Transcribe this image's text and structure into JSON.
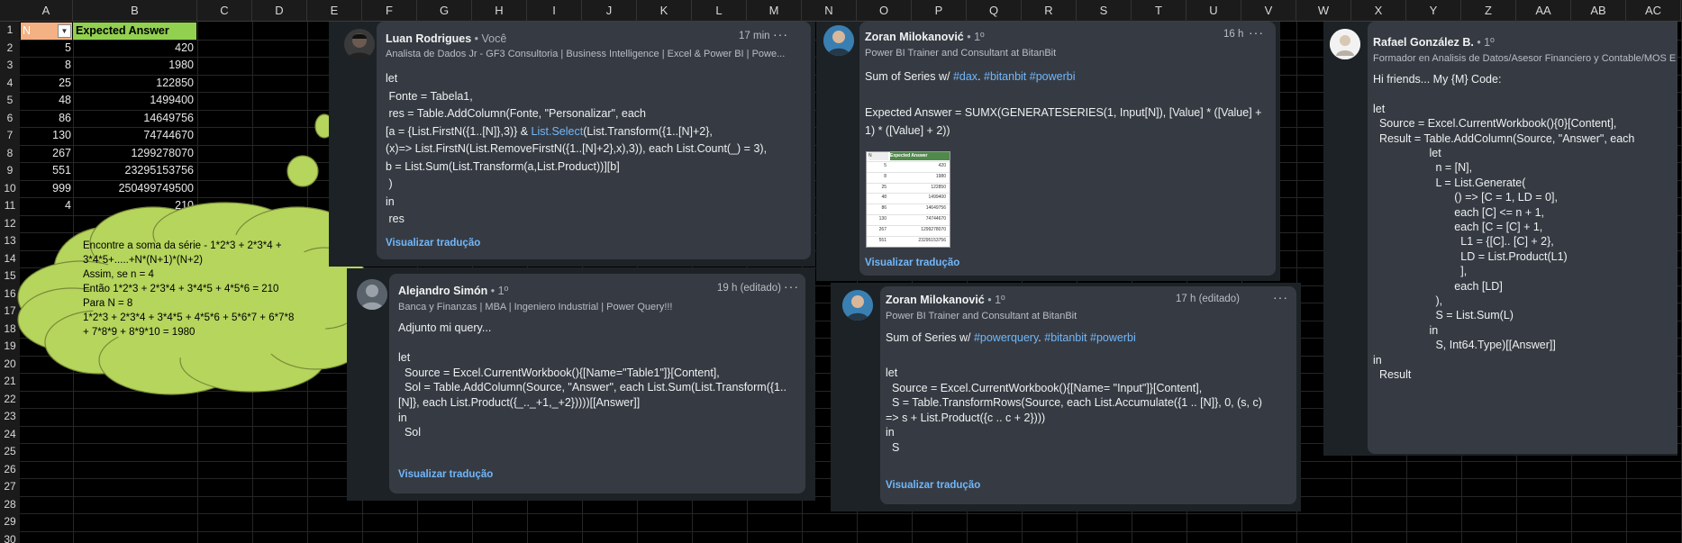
{
  "spreadsheet": {
    "columns": [
      "A",
      "B",
      "C",
      "D",
      "E",
      "F",
      "G",
      "H",
      "I",
      "J",
      "K",
      "L",
      "M",
      "N",
      "O",
      "P",
      "Q",
      "R",
      "S",
      "T",
      "U",
      "V",
      "W",
      "X",
      "Y",
      "Z",
      "AA",
      "AB",
      "AC"
    ],
    "rows": [
      "1",
      "2",
      "3",
      "4",
      "5",
      "6",
      "7",
      "8",
      "9",
      "10",
      "11",
      "12",
      "13",
      "14",
      "15",
      "16",
      "17",
      "18",
      "19",
      "20",
      "21",
      "22",
      "23",
      "24",
      "25",
      "26",
      "27",
      "28",
      "29",
      "30"
    ],
    "header_n": "N",
    "header_expected": "Expected Answer",
    "data": [
      {
        "n": "5",
        "answer": "420"
      },
      {
        "n": "8",
        "answer": "1980"
      },
      {
        "n": "25",
        "answer": "122850"
      },
      {
        "n": "48",
        "answer": "1499400"
      },
      {
        "n": "86",
        "answer": "14649756"
      },
      {
        "n": "130",
        "answer": "74744670"
      },
      {
        "n": "267",
        "answer": "1299278070"
      },
      {
        "n": "551",
        "answer": "23295153756"
      },
      {
        "n": "999",
        "answer": "250499749500"
      },
      {
        "n": "4",
        "answer": "210"
      }
    ]
  },
  "bubble": {
    "color": "#b5d55c",
    "lines": [
      "Encontre a soma da série - 1*2*3 + 2*3*4 +",
      "3*4*5+.....+N*(N+1)*(N+2)",
      "Assim, se n = 4",
      "Então 1*2*3 + 2*3*4 + 3*4*5 + 4*5*6 = 210",
      "Para N = 8",
      "1*2*3 + 2*3*4 + 3*4*5 + 4*5*6 + 5*6*7 + 6*7*8",
      "+ 7*8*9 + 8*9*10 = 1980"
    ]
  },
  "comments": {
    "luan": {
      "name": "Luan Rodrigues",
      "degree": " • Você",
      "subtitle": "Analista de Dados Jr - GF3 Consultoria | Business Intelligence | Excel & Power BI | Powe...",
      "time": "17 min",
      "more": "···",
      "lines": [
        "let",
        " Fonte = Tabela1,",
        " res = Table.AddColumn(Fonte, \"Personalizar\", each",
        "[a = {List.FirstN({1..[N]},3)} & ",
        "(x)=> List.FirstN(List.RemoveFirstN({1..[N]+2},x),3)), each List.Count(_) = 3),",
        "b = List.Sum(List.Transform(a,List.Product))][b]",
        " )",
        "in",
        " res"
      ],
      "line4_link": "List.Select",
      "line4_tail": "(List.Transform({1..[N]+2},",
      "translate": "Visualizar tradução"
    },
    "zoran1": {
      "name": "Zoran Milokanović",
      "degree": " • 1º",
      "subtitle": "Power BI Trainer and Consultant at BitanBit",
      "time": "16 h",
      "more": "···",
      "intro": "Sum of Series w/ ",
      "tag1": "#dax",
      "sep": ". ",
      "tag2": "#bitanbit",
      "space": " ",
      "tag3": "#powerbi",
      "formula1": "Expected Answer = SUMX(GENERATESERIES(1, Input[N]), [Value] * ([Value] +",
      "formula2": "1) * ([Value] + 2))",
      "translate": "Visualizar tradução",
      "thumb": {
        "h1": "N",
        "h2": "Expected Answer",
        "rows": [
          {
            "n": "5",
            "v": "420"
          },
          {
            "n": "8",
            "v": "1980"
          },
          {
            "n": "25",
            "v": "122850"
          },
          {
            "n": "48",
            "v": "1499400"
          },
          {
            "n": "86",
            "v": "14649756"
          },
          {
            "n": "130",
            "v": "74744670"
          },
          {
            "n": "267",
            "v": "1299278070"
          },
          {
            "n": "551",
            "v": "23295153756"
          }
        ]
      }
    },
    "rafael": {
      "name": "Rafael González B.",
      "degree": " • 1º",
      "subtitle": "Formador en Analisis de Datos/Asesor Financiero y Contable/MOS E",
      "lines": [
        "Hi friends... My {M} Code:",
        "",
        "let",
        "  Source = Excel.CurrentWorkbook(){0}[Content],",
        "  Result = Table.AddColumn(Source, \"Answer\", each",
        "                  let",
        "                    n = [N],",
        "                    L = List.Generate(",
        "                          () => [C = 1, LD = 0],",
        "                          each [C] <= n + 1,",
        "                          each [C = [C] + 1,",
        "                            L1 = {[C].. [C] + 2},",
        "                            LD = List.Product(L1)",
        "                            ],",
        "                          each [LD]",
        "                    ),",
        "                    S = List.Sum(L)",
        "                  in",
        "                    S, Int64.Type)[[Answer]]",
        "in",
        "  Result"
      ]
    },
    "alejandro": {
      "name": "Alejandro Simón",
      "degree": " • 1º",
      "subtitle": "Banca y Finanzas | MBA | Ingeniero Industrial | Power Query!!!",
      "time": "19 h (editado)",
      "more": "···",
      "lines": [
        "Adjunto mi query...",
        "",
        "let",
        "  Source = Excel.CurrentWorkbook(){[Name=\"Table1\"]}[Content],",
        "  Sol = Table.AddColumn(Source, \"Answer\", each List.Sum(List.Transform({1..",
        "[N]}, each List.Product({_.._+1,_+2}))))[[Answer]]",
        "in",
        "  Sol"
      ],
      "translate": "Visualizar tradução"
    },
    "zoran2": {
      "name": "Zoran Milokanović",
      "degree": " • 1º",
      "subtitle": "Power BI Trainer and Consultant at BitanBit",
      "time": "17 h (editado)",
      "more": "···",
      "intro": "Sum of Series w/ ",
      "tag1": "#powerquery",
      "sep": ". ",
      "tag2": "#bitanbit",
      "space": " ",
      "tag3": "#powerbi",
      "lines": [
        "let",
        "  Source = Excel.CurrentWorkbook(){[Name= \"Input\"]}[Content],",
        "  S = Table.TransformRows(Source, each List.Accumulate({1 .. [N]}, 0, (s, c)",
        "=> s + List.Product({c .. c + 2})))",
        "in",
        "  S"
      ],
      "translate": "Visualizar tradução"
    }
  }
}
